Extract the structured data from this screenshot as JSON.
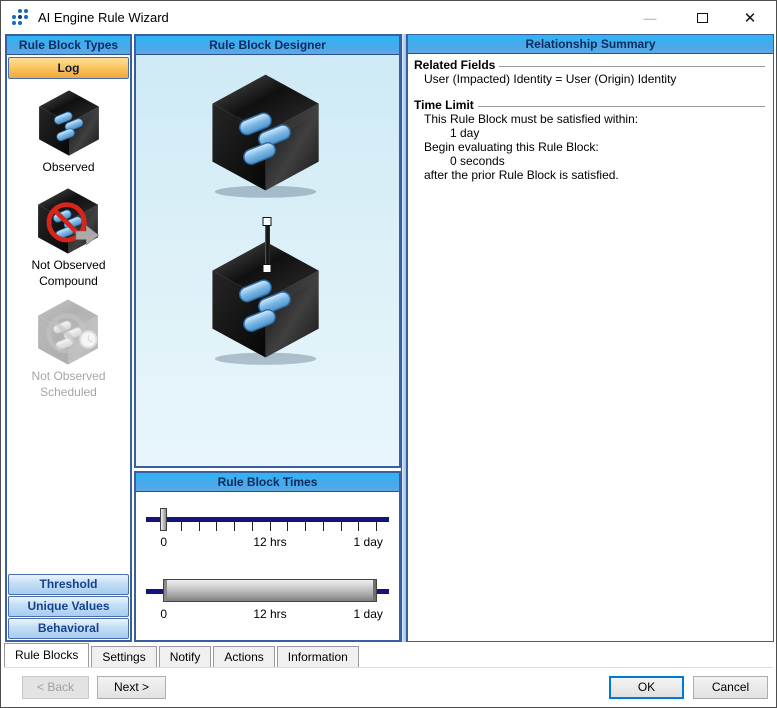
{
  "window": {
    "title": "AI Engine Rule Wizard"
  },
  "left_panel": {
    "header": "Rule Block Types",
    "log_button": "Log",
    "items": [
      {
        "label": "Observed",
        "label2": "",
        "icon": "observed-cube-icon",
        "enabled": true
      },
      {
        "label": "Not Observed",
        "label2": "Compound",
        "icon": "not-observed-compound-icon",
        "enabled": true
      },
      {
        "label": "Not Observed",
        "label2": "Scheduled",
        "icon": "not-observed-scheduled-icon",
        "enabled": false
      }
    ],
    "bottom_buttons": [
      "Threshold",
      "Unique Values",
      "Behavioral"
    ]
  },
  "designer": {
    "header": "Rule Block Designer",
    "blocks": [
      "observed-rule-block",
      "observed-rule-block"
    ],
    "connector": "rule-block-link"
  },
  "times": {
    "header": "Rule Block Times",
    "slider1": {
      "labels": [
        "0",
        "12 hrs",
        "1 day"
      ],
      "handle_position": "0"
    },
    "slider2": {
      "labels": [
        "0",
        "12 hrs",
        "1 day"
      ],
      "range": [
        "0",
        "1 day"
      ]
    }
  },
  "summary": {
    "header": "Relationship Summary",
    "sections": [
      {
        "title": "Related Fields",
        "lines": [
          "User (Impacted) Identity = User (Origin) Identity"
        ]
      },
      {
        "title": "Time Limit",
        "lines": [
          "This Rule Block must be satisfied within:",
          "1 day",
          "Begin evaluating this Rule Block:",
          "0 seconds",
          "after the prior Rule Block is satisfied."
        ]
      }
    ]
  },
  "tabs": [
    "Rule Blocks",
    "Settings",
    "Notify",
    "Actions",
    "Information"
  ],
  "active_tab": "Rule Blocks",
  "nav_buttons": {
    "back": "< Back",
    "next": "Next >"
  },
  "dialog_buttons": {
    "ok": "OK",
    "cancel": "Cancel"
  },
  "colors": {
    "header_gradient_top": "#2eb6f5",
    "header_gradient_bottom": "#5fa8e4",
    "panel_border": "#3a5fa0",
    "log_button_orange": "#f2a73d",
    "slider_track_navy": "#14147a",
    "ok_focus_border": "#0078d7"
  }
}
